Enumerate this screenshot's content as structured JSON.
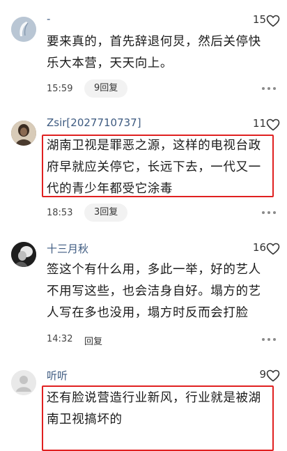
{
  "comments": [
    {
      "username": "-",
      "likes": "15",
      "lines": [
        "要来真的，首先辞退何炅，然后关停快",
        "乐大本营，天天向上。"
      ],
      "time": "15:59",
      "reply": "9回复"
    },
    {
      "username": "Zsir[2027710737]",
      "likes": "11",
      "lines": [
        "湖南卫视是罪恶之源，这样的电视台政",
        "府早就应关停它，长远下去，一代又一",
        "代的青少年都受它涂毒"
      ],
      "time": "18:53",
      "reply": "3回复"
    },
    {
      "username": "十三月秋",
      "likes": "16",
      "lines": [
        "签这个有什么用，多此一举，好的艺人",
        "不用写这些，也会洁身自好。塌方的艺",
        "人写在多也没用，塌方时反而会打脸"
      ],
      "time": "14:32",
      "reply": "回复"
    },
    {
      "username": "听听",
      "likes": "9",
      "lines": [
        "还有脸说营造行业新风，行业就是被湖",
        "南卫视搞坏的"
      ],
      "time": "",
      "reply": ""
    }
  ],
  "icons": {
    "like": "heart-outline-icon",
    "more": "more-dots-icon"
  },
  "colors": {
    "username": "#3d5a80",
    "highlight_border": "#e02020",
    "reply_pill_bg": "#f2f2f2"
  }
}
